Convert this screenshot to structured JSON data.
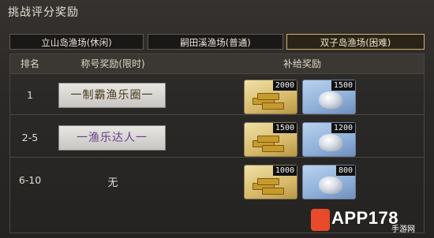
{
  "window": {
    "title": "挑战评分奖励"
  },
  "tabs": [
    {
      "label": "立山岛渔场(休闲)",
      "active": false
    },
    {
      "label": "嗣田溪渔场(普通)",
      "active": false
    },
    {
      "label": "双子岛渔场(困难)",
      "active": true
    }
  ],
  "table": {
    "headers": {
      "rank": "排名",
      "title": "称号奖励(限时)",
      "reward": "补给奖励"
    },
    "rows": [
      {
        "rank": "1",
        "title": "一制霸渔乐圈一",
        "gold": "2000",
        "silver": "1500"
      },
      {
        "rank": "2-5",
        "title": "一渔乐达人一",
        "gold": "1500",
        "silver": "1200"
      },
      {
        "rank": "6-10",
        "title": "无",
        "gold": "1000",
        "silver": "800"
      }
    ]
  },
  "watermark": {
    "brand": "APP178",
    "sub": "手游网"
  },
  "colors": {
    "active_tab_border": "#d3b371",
    "gold_item": "#d7bb6d",
    "silver_item": "#8fb0d9"
  },
  "icons": {
    "gold": "gold-bars-icon",
    "silver": "silver-ore-icon"
  }
}
